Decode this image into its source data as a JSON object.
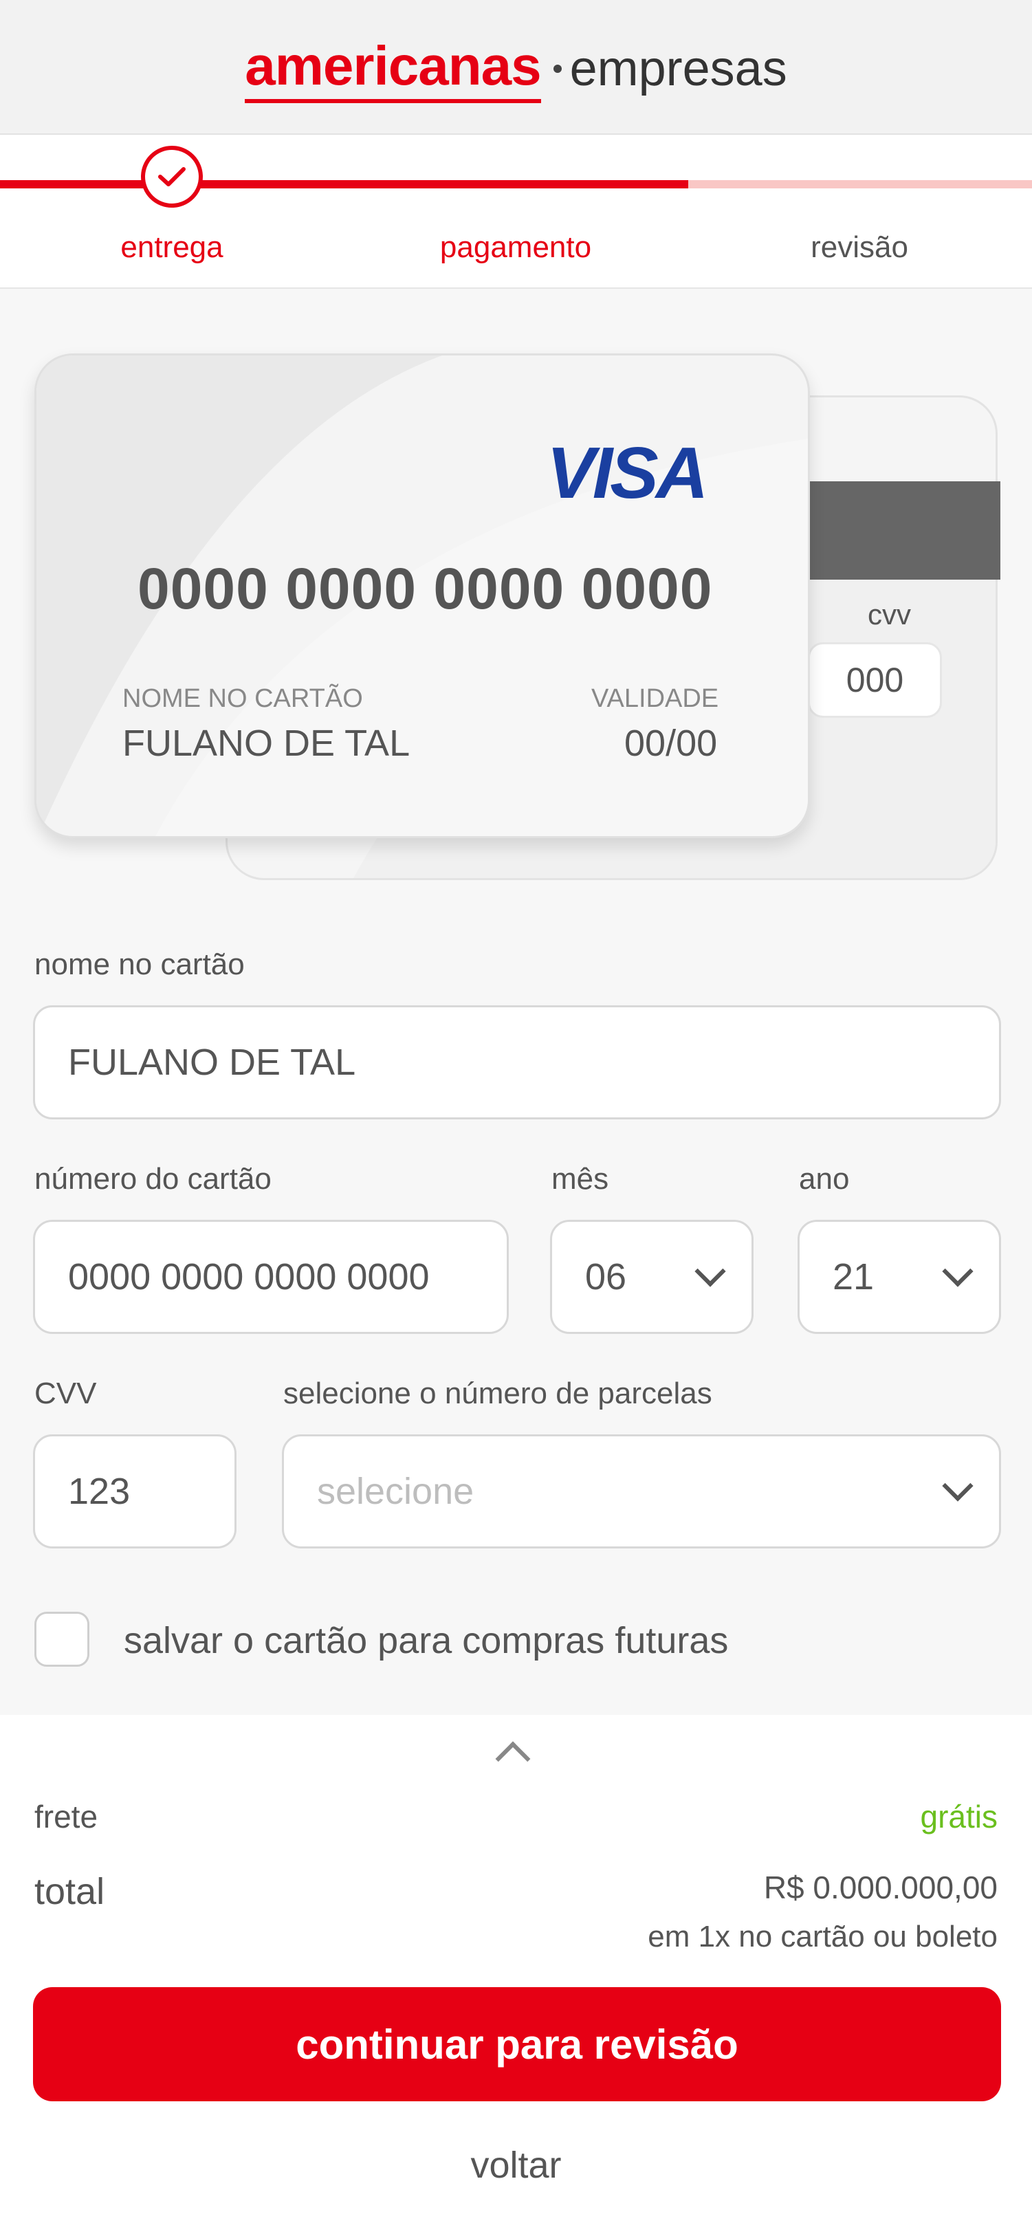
{
  "header": {
    "brand_primary": "americanas",
    "brand_secondary": "empresas"
  },
  "stepper": {
    "steps": [
      {
        "label": "entrega",
        "state": "completed"
      },
      {
        "label": "pagamento",
        "state": "current"
      },
      {
        "label": "revisão",
        "state": "pending"
      }
    ],
    "progress": 0.667
  },
  "card_preview": {
    "brand": "VISA",
    "number": "0000 0000 0000 0000",
    "name_caption": "NOME NO CARTÃO",
    "name_value": "FULANO DE TAL",
    "valid_caption": "VALIDADE",
    "valid_value": "00/00",
    "cvv_caption": "cvv",
    "cvv_value": "000"
  },
  "form": {
    "name_label": "nome no cartão",
    "name_value": "FULANO DE TAL",
    "number_label": "número do cartão",
    "number_value": "0000 0000 0000 0000",
    "month_label": "mês",
    "month_value": "06",
    "year_label": "ano",
    "year_value": "21",
    "cvv_label": "CVV",
    "cvv_value": "123",
    "installments_label": "selecione o número de parcelas",
    "installments_placeholder": "selecione",
    "save_card_label": "salvar o cartão para compras futuras",
    "save_card_checked": false
  },
  "summary": {
    "frete_label": "frete",
    "frete_value": "grátis",
    "total_label": "total",
    "total_value": "R$ 0.000.000,00",
    "installments_note": "em 1x no cartão ou boleto"
  },
  "actions": {
    "continue_label": "continuar para revisão",
    "back_label": "voltar"
  },
  "colors": {
    "brand_red": "#e60014",
    "progress_track": "#f9c7c5",
    "free_green": "#6abf1e",
    "visa_blue": "#1a3fa0"
  },
  "icons": {
    "completed_step": "check-icon",
    "dropdown": "chevron-down-icon",
    "expand_summary": "chevron-up-icon"
  }
}
